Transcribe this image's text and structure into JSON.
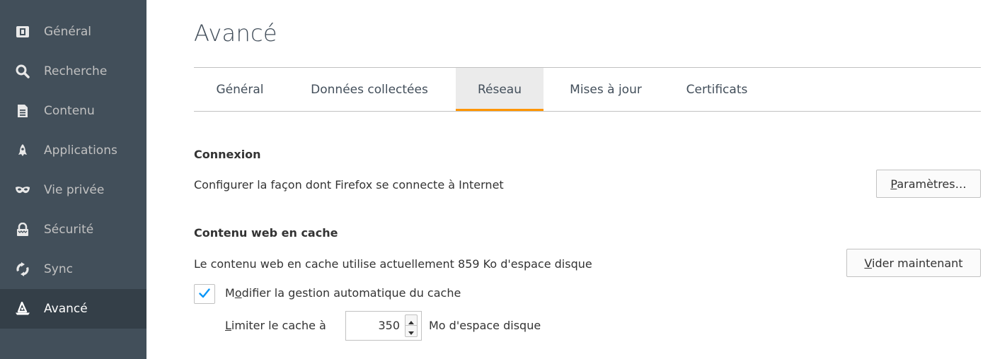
{
  "sidebar": {
    "items": [
      {
        "label": "Général",
        "icon": "general-icon"
      },
      {
        "label": "Recherche",
        "icon": "search-icon"
      },
      {
        "label": "Contenu",
        "icon": "document-icon"
      },
      {
        "label": "Applications",
        "icon": "rocket-icon"
      },
      {
        "label": "Vie privée",
        "icon": "mask-icon"
      },
      {
        "label": "Sécurité",
        "icon": "lock-icon"
      },
      {
        "label": "Sync",
        "icon": "sync-icon"
      },
      {
        "label": "Avancé",
        "icon": "wizard-hat-icon"
      }
    ],
    "selected": "Avancé"
  },
  "page": {
    "title": "Avancé"
  },
  "tabs": [
    {
      "label": "Général"
    },
    {
      "label": "Données collectées"
    },
    {
      "label": "Réseau",
      "selected": true
    },
    {
      "label": "Mises à jour"
    },
    {
      "label": "Certificats"
    }
  ],
  "connexion": {
    "heading": "Connexion",
    "description": "Configurer la façon dont Firefox se connecte à Internet",
    "button_label_access": "P",
    "button_label_rest": "aramètres…"
  },
  "cache": {
    "heading": "Contenu web en cache",
    "description": "Le contenu web en cache utilise actuellement 859 Ko d'espace disque",
    "button_label_access": "V",
    "button_label_rest": "ider maintenant",
    "override_checked": true,
    "override_label_pre": "M",
    "override_label_access": "o",
    "override_label_rest": "difier la gestion automatique du cache",
    "limit_label_access": "L",
    "limit_label_rest": "imiter le cache à",
    "limit_value": "350",
    "unit_label": "Mo d'espace disque"
  },
  "colors": {
    "sidebar_bg": "#424f5a",
    "sidebar_selected_bg": "#343f48",
    "accent_orange": "#ff9500",
    "checkbox_blue": "#0996f8"
  }
}
